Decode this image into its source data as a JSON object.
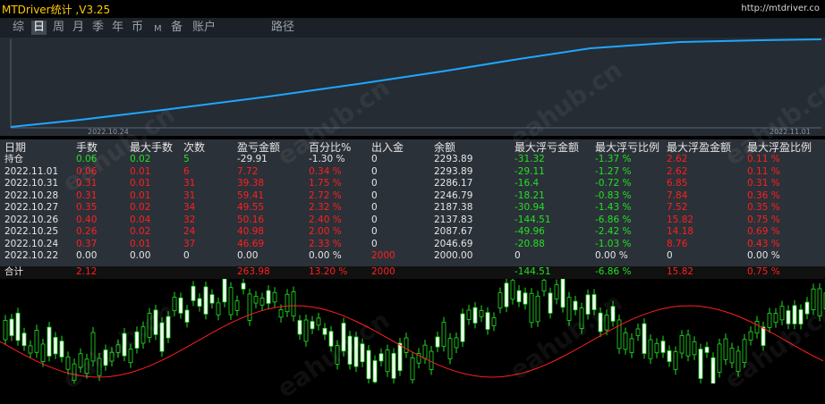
{
  "app": {
    "title": "MTDriver统计 ,V3.25",
    "url": "http://mtdriver.co"
  },
  "tabs": [
    "综",
    "日",
    "周",
    "月",
    "季",
    "年",
    "币",
    "M",
    "备",
    "账户",
    "路径"
  ],
  "active_tab": "日",
  "equity": {
    "start_label": "2022.10.24",
    "end_label": "2022.11.01",
    "line_color": "#1ea7ff"
  },
  "table": {
    "columns": [
      "日期",
      "手数",
      "最大手数",
      "次数",
      "盈亏金额",
      "百分比%",
      "出入金",
      "余额",
      "最大浮亏金额",
      "最大浮亏比例",
      "最大浮盈金额",
      "最大浮盈比例"
    ],
    "rows": [
      {
        "cells": [
          "持仓",
          "0.06",
          "0.02",
          "5",
          "-29.91",
          "-1.30 %",
          "0",
          "2293.89",
          "-31.32",
          "-1.37 %",
          "2.62",
          "0.11 %"
        ],
        "kind": "hold"
      },
      {
        "cells": [
          "2022.11.01",
          "0.06",
          "0.01",
          "6",
          "7.72",
          "0.34 %",
          "0",
          "2293.89",
          "-29.11",
          "-1.27 %",
          "2.62",
          "0.11 %"
        ],
        "kind": "day"
      },
      {
        "cells": [
          "2022.10.31",
          "0.31",
          "0.01",
          "31",
          "39.38",
          "1.75 %",
          "0",
          "2286.17",
          "-16.4",
          "-0.72 %",
          "6.85",
          "0.31 %"
        ],
        "kind": "day"
      },
      {
        "cells": [
          "2022.10.28",
          "0.31",
          "0.01",
          "31",
          "59.41",
          "2.72 %",
          "0",
          "2246.79",
          "-18.21",
          "-0.83 %",
          "7.84",
          "0.36 %"
        ],
        "kind": "day"
      },
      {
        "cells": [
          "2022.10.27",
          "0.35",
          "0.02",
          "34",
          "49.55",
          "2.32 %",
          "0",
          "2187.38",
          "-30.94",
          "-1.43 %",
          "7.52",
          "0.35 %"
        ],
        "kind": "day"
      },
      {
        "cells": [
          "2022.10.26",
          "0.40",
          "0.04",
          "32",
          "50.16",
          "2.40 %",
          "0",
          "2137.83",
          "-144.51",
          "-6.86 %",
          "15.82",
          "0.75 %"
        ],
        "kind": "day"
      },
      {
        "cells": [
          "2022.10.25",
          "0.26",
          "0.02",
          "24",
          "40.98",
          "2.00 %",
          "0",
          "2087.67",
          "-49.96",
          "-2.42 %",
          "14.18",
          "0.69 %"
        ],
        "kind": "day"
      },
      {
        "cells": [
          "2022.10.24",
          "0.37",
          "0.01",
          "37",
          "46.69",
          "2.33 %",
          "0",
          "2046.69",
          "-20.88",
          "-1.03 %",
          "8.76",
          "0.43 %"
        ],
        "kind": "day"
      },
      {
        "cells": [
          "2022.10.22",
          "0.00",
          "0.00",
          "0",
          "0.00",
          "0.00 %",
          "2000",
          "2000.00",
          "0",
          "0.00 %",
          "0",
          "0.00 %"
        ],
        "kind": "deposit"
      }
    ],
    "total": [
      "合计",
      "2.12",
      "",
      "",
      "263.98",
      "13.20 %",
      "2000",
      "",
      "-144.51",
      "-6.86 %",
      "15.82",
      "0.75 %"
    ]
  },
  "watermark": "eahub.cn",
  "colors": {
    "green": "#22e022",
    "red": "#ff1f1f",
    "text": "#e6e6e6",
    "equity_line": "#1ea7ff"
  }
}
